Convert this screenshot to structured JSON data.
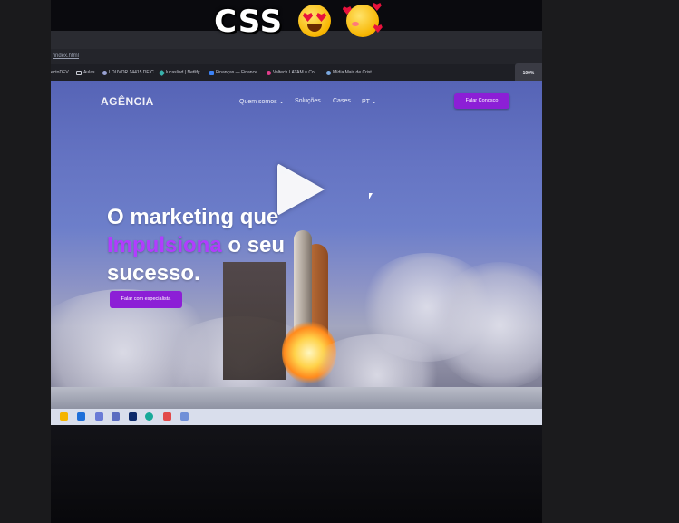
{
  "caption": {
    "text": "CSS",
    "emoji_1": "smiling-face-with-heart-eyes",
    "emoji_2": "smiling-face-with-hearts"
  },
  "browser": {
    "address": "/index.html",
    "zoom": "100%",
    "bookmarks": [
      {
        "label": "ectoDEV",
        "icon": "folder-icon"
      },
      {
        "label": "Aulas",
        "icon": "folder-icon"
      },
      {
        "label": "LOUVOR 14415 DE C...",
        "icon": "favicon-icon"
      },
      {
        "label": "lucasliad | Netlify",
        "icon": "netlify-icon"
      },
      {
        "label": "Finanças — Finance...",
        "icon": "finance-icon"
      },
      {
        "label": "Valtech LATAM = Co...",
        "icon": "valtech-icon"
      },
      {
        "label": "Mídia Mais de Crist...",
        "icon": "favicon-icon"
      }
    ]
  },
  "site": {
    "logo": "AGÊNCIA",
    "nav": [
      "Quem somos",
      "Soluções",
      "Cases",
      "PT"
    ],
    "nav_chevron": "⌄",
    "cta_top": "Falar Conosco",
    "hero_line1": "O marketing que",
    "hero_accent": "Impulsiona",
    "hero_line2_rest": "o seu",
    "hero_line3": "sucesso.",
    "cta_hero": "Falar com especialista"
  },
  "colors": {
    "accent": "#8c1fd6",
    "hero_accent": "#b23cff"
  },
  "player": {
    "state": "paused",
    "icon": "play-icon"
  }
}
